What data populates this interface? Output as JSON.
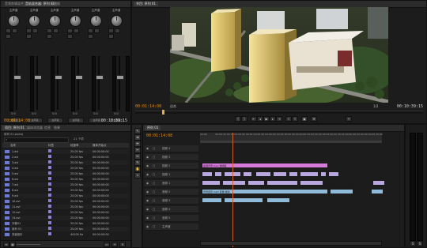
{
  "mixer": {
    "tabs": [
      "音频剪辑混合器",
      "音轨混合器: 序列 01",
      "元数据"
    ],
    "channels": [
      {
        "label": "主声道",
        "value": "0.0",
        "out": "主声道"
      },
      {
        "label": "主声道",
        "value": "0.0",
        "out": "主声道"
      },
      {
        "label": "主声道",
        "value": "0.0",
        "out": "主声道"
      },
      {
        "label": "主声道",
        "value": "0.0",
        "out": "主声道"
      },
      {
        "label": "主声道",
        "value": "0.0",
        "out": "主声道"
      },
      {
        "label": "主声道",
        "value": "0.0",
        "out": "主声道"
      }
    ],
    "master": {
      "label": "主声道",
      "value": "0.0"
    },
    "timecode_left": "00:01:14:08",
    "timecode_right": "00:10:39:15"
  },
  "program": {
    "tab": "节目: 序列 01",
    "timecode_left": "00:01:14:08",
    "zoom": "1/2",
    "timecode_right": "00:10:39:15",
    "fit": "适合"
  },
  "project": {
    "tabs": [
      "项目: 序列 01",
      "媒体浏览器",
      "信息",
      "效果"
    ],
    "filename": "序列 01.prproj",
    "item_count": "21 个项",
    "search_placeholder": "",
    "columns": [
      "名称",
      "标签",
      "帧速率",
      "媒体开始点"
    ],
    "rows": [
      {
        "name": "1.avi",
        "fps": "25.00 fps",
        "start": "00:00:00:00"
      },
      {
        "name": "2.avi",
        "fps": "25.00 fps",
        "start": "00:00:00:00"
      },
      {
        "name": "3.avi",
        "fps": "25.00 fps",
        "start": "00:00:00:00"
      },
      {
        "name": "4.avi",
        "fps": "25.00 fps",
        "start": "00:00:00:00"
      },
      {
        "name": "5.avi",
        "fps": "25.00 fps",
        "start": "00:00:00:00"
      },
      {
        "name": "6.avi",
        "fps": "25.00 fps",
        "start": "00:00:00:00"
      },
      {
        "name": "7.avi",
        "fps": "25.00 fps",
        "start": "00:00:00:00"
      },
      {
        "name": "8.avi",
        "fps": "25.00 fps",
        "start": "00:00:00:00"
      },
      {
        "name": "9.avi",
        "fps": "25.00 fps",
        "start": "00:00:00:00"
      },
      {
        "name": "10.avi",
        "fps": "25.00 fps",
        "start": "00:00:00:00"
      },
      {
        "name": "11.avi",
        "fps": "25.00 fps",
        "start": "00:00:00:00"
      },
      {
        "name": "12.avi",
        "fps": "25.00 fps",
        "start": "00:00:00:00"
      },
      {
        "name": "13.avi",
        "fps": "25.00 fps",
        "start": "00:00:00:00"
      },
      {
        "name": "字幕01",
        "fps": "25.00 fps",
        "start": "00:00:00:00"
      },
      {
        "name": "序列 01",
        "fps": "25.00 fps",
        "start": "00:00:00:00"
      },
      {
        "name": "背景音乐",
        "fps": "44100 Hz",
        "start": "00:00:00:00"
      }
    ]
  },
  "timeline": {
    "tab": "序列 01",
    "timecode": "00:01:14:08",
    "ruler_ticks": [
      "00:00",
      "00:00:30:00",
      "00:01:00:00",
      "00:01:30:00",
      "00:02:00:00",
      "00:02:30:00",
      "00:03:00:00",
      "00:03:30:00",
      "00:04:00:00",
      "00:04:30:00",
      "00:05:00:00",
      "00:05:30:00"
    ],
    "tracks": [
      {
        "name": "视频 4"
      },
      {
        "name": "视频 3"
      },
      {
        "name": "视频 2"
      },
      {
        "name": "视频 1"
      },
      {
        "name": "音频 1"
      },
      {
        "name": "音频 2"
      },
      {
        "name": "音频 3"
      },
      {
        "name": "音频 4"
      },
      {
        "name": "音频 5"
      },
      {
        "name": "主声道"
      }
    ],
    "pink_clip_label": "蓝调背景.mov 透明度",
    "audio_clip_label": "背景音乐.mp3 音量:级别"
  },
  "colors": {
    "accent_timecode": "#e38a19",
    "video_clip": "#b9a7e0",
    "title_clip": "#d67ad9",
    "audio_clip": "#8fbad9"
  }
}
